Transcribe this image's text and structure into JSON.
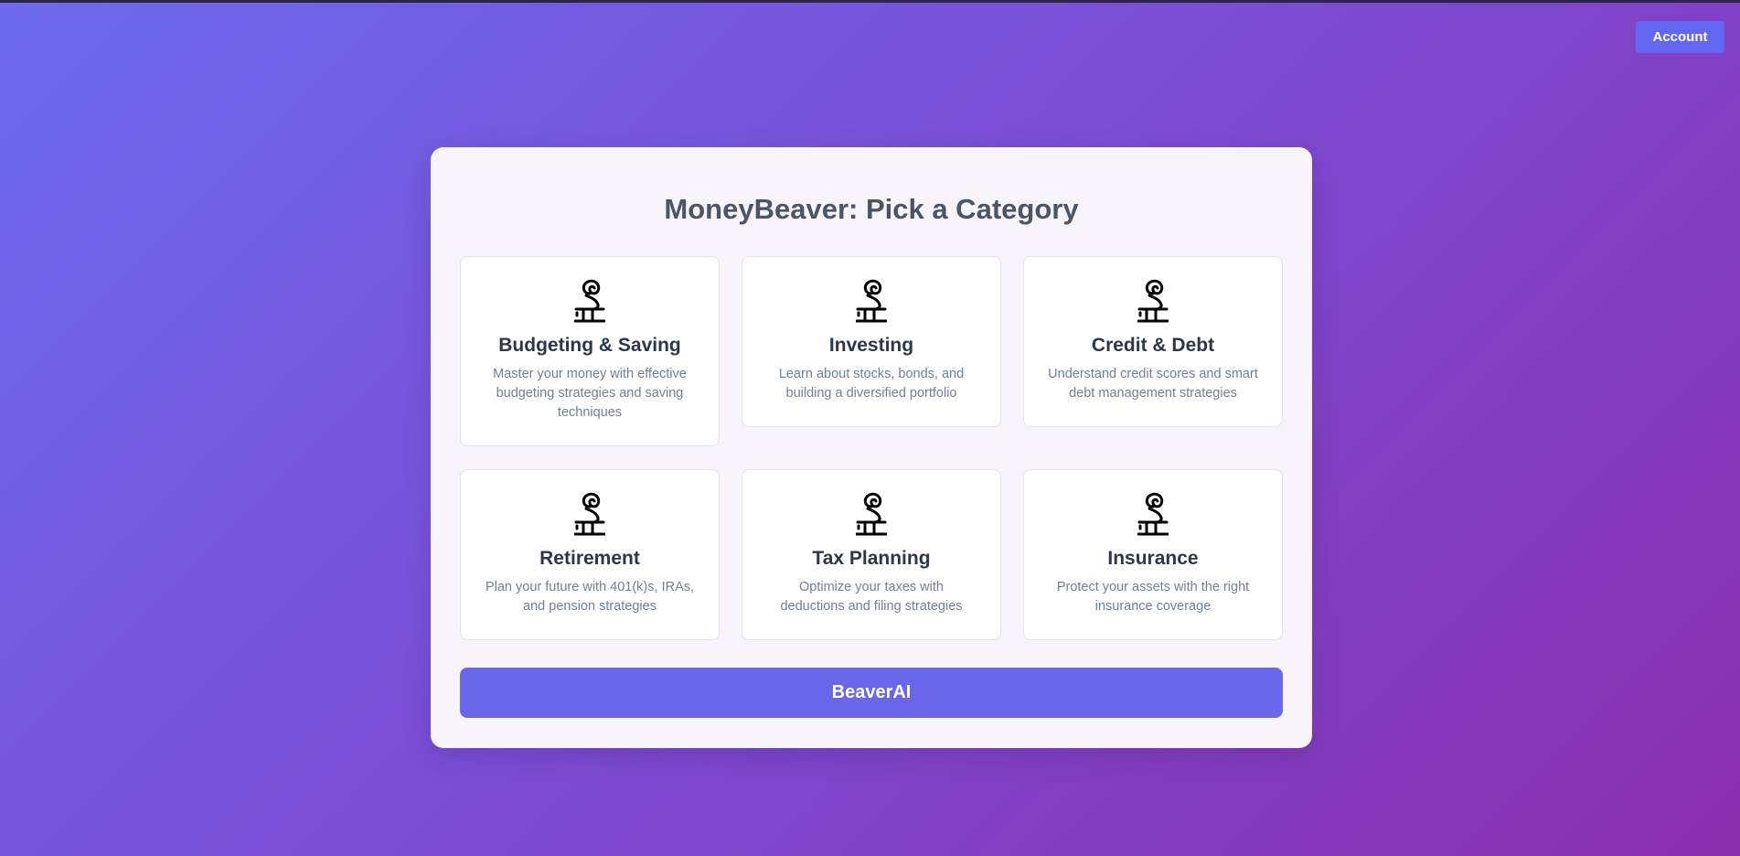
{
  "header": {
    "account_label": "Account"
  },
  "panel": {
    "title": "MoneyBeaver: Pick a Category",
    "categories": [
      {
        "title": "Budgeting & Saving",
        "description": "Master your money with effective budgeting strategies and saving techniques",
        "icon": "beaver-statue-icon"
      },
      {
        "title": "Investing",
        "description": "Learn about stocks, bonds, and building a diversified portfolio",
        "icon": "beaver-statue-icon"
      },
      {
        "title": "Credit & Debt",
        "description": "Understand credit scores and smart debt management strategies",
        "icon": "beaver-statue-icon"
      },
      {
        "title": "Retirement",
        "description": "Plan your future with 401(k)s, IRAs, and pension strategies",
        "icon": "beaver-statue-icon"
      },
      {
        "title": "Tax Planning",
        "description": "Optimize your taxes with deductions and filing strategies",
        "icon": "beaver-statue-icon"
      },
      {
        "title": "Insurance",
        "description": "Protect your assets with the right insurance coverage",
        "icon": "beaver-statue-icon"
      }
    ],
    "ai_button_label": "BeaverAI"
  },
  "colors": {
    "gradient_start": "#6c6aec",
    "gradient_end": "#8a2fae",
    "accent": "#6366f1",
    "panel_bg": "#f7f4fb",
    "title_text": "#4a5568",
    "card_title": "#2d3748",
    "card_desc": "#718096"
  }
}
